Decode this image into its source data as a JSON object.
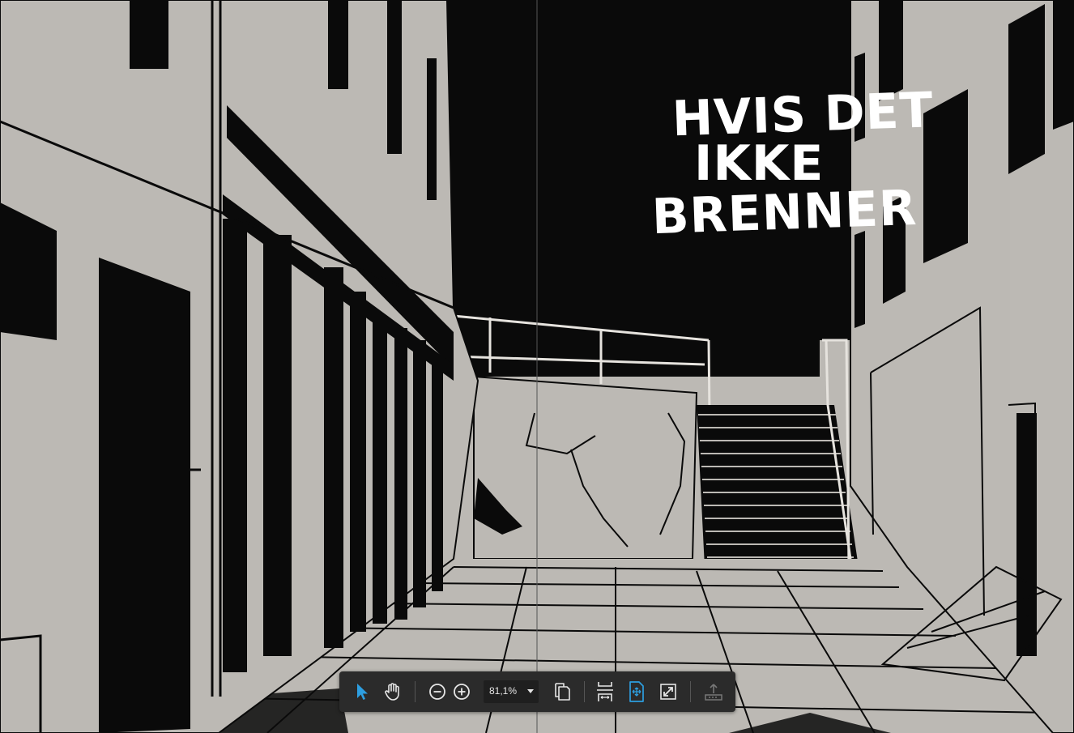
{
  "document": {
    "title_lines": [
      "HVIS DET",
      "IKKE",
      "BRENNER"
    ]
  },
  "toolbar": {
    "zoom_value": "81,1%",
    "tools": [
      {
        "name": "select-tool",
        "icon": "pointer-arrow-icon",
        "active": true
      },
      {
        "name": "hand-tool",
        "icon": "hand-icon",
        "active": false
      },
      {
        "name": "zoom-out",
        "icon": "minus-circle-icon"
      },
      {
        "name": "zoom-in",
        "icon": "plus-circle-icon"
      },
      {
        "name": "page-display",
        "icon": "copy-pages-icon"
      },
      {
        "name": "fit-width",
        "icon": "fit-width-icon"
      },
      {
        "name": "fit-page",
        "icon": "fit-page-icon",
        "active": true
      },
      {
        "name": "full-screen",
        "icon": "expand-arrows-icon"
      },
      {
        "name": "upload",
        "icon": "upload-icon",
        "disabled": true
      }
    ]
  },
  "colors": {
    "page_gray": "#bcb9b4",
    "ink": "#0a0a0a",
    "toolbar_bg": "#2b2b2b",
    "accent": "#2d9ee0",
    "icon": "#e6e6e6",
    "icon_disabled": "#777777"
  }
}
